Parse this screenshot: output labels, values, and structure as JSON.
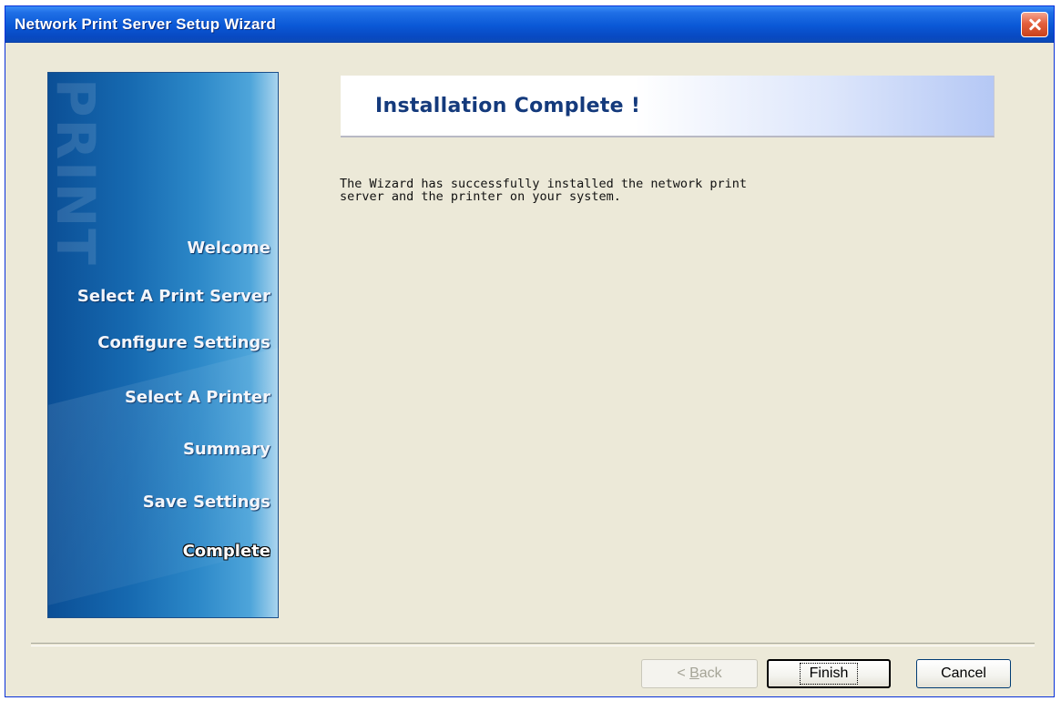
{
  "window": {
    "title": "Network Print Server Setup Wizard"
  },
  "sidebar": {
    "watermark": "PRINT",
    "steps": [
      {
        "label": "Welcome"
      },
      {
        "label": "Select A Print Server"
      },
      {
        "label": "Configure Settings"
      },
      {
        "label": "Select  A  Printer"
      },
      {
        "label": "Summary"
      },
      {
        "label": "Save Settings"
      },
      {
        "label": "Complete",
        "active": true
      }
    ]
  },
  "content": {
    "title": "Installation Complete !",
    "message": "The Wizard has successfully installed the network print\nserver and the printer on your system."
  },
  "buttons": {
    "back_prefix": "< ",
    "back_mnemonic": "B",
    "back_rest": "ack",
    "finish": "Finish",
    "cancel": "Cancel"
  }
}
